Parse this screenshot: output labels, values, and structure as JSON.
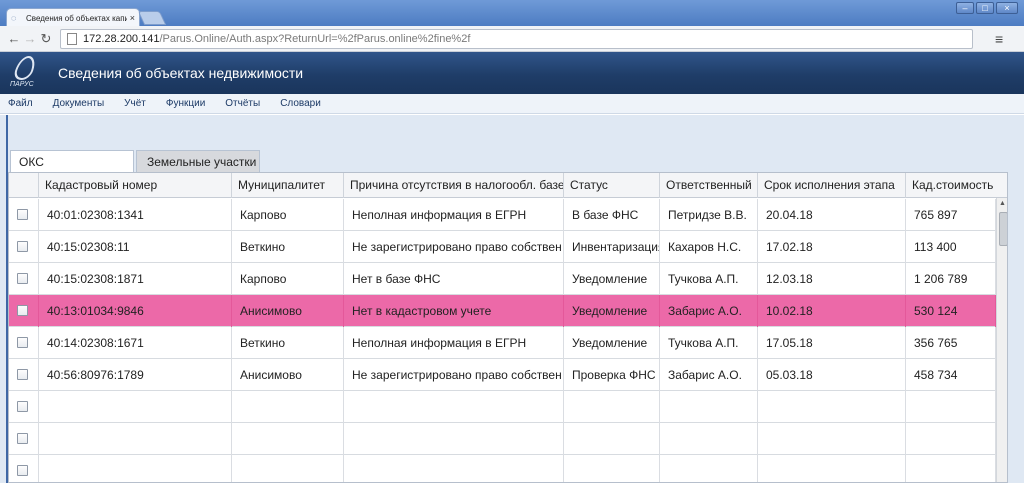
{
  "browser": {
    "tab_title": "Сведения об объектах капи",
    "tab_close": "×",
    "url_host": "172.28.200.141",
    "url_path": "/Parus.Online/Auth.aspx?ReturnUrl=%2fParus.online%2fine%2f"
  },
  "app": {
    "logo_text": "ПАРУС",
    "title": "Сведения об объектах  недвижимости"
  },
  "menu": [
    "Файл",
    "Документы",
    "Учёт",
    "Функции",
    "Отчёты",
    "Словари"
  ],
  "tabs": [
    {
      "label": "ОКС"
    },
    {
      "label": "Земельные участки"
    }
  ],
  "grid": {
    "columns": [
      "Кадастровый номер",
      "Муниципалитет",
      "Причина отсутствия в налогообл. базе",
      "Статус",
      "Ответственный",
      "Срок исполнения этапа",
      "Кад.стоимость"
    ],
    "rows": [
      {
        "cadastral": "40:01:02308:1341",
        "municipality": "Карпово",
        "reason": "Неполная информация в ЕГРН",
        "status": "В базе ФНС",
        "responsible": "Петридзе В.В.",
        "deadline": "20.04.18",
        "cost": "765 897"
      },
      {
        "cadastral": "40:15:02308:11",
        "municipality": "Веткино",
        "reason": "Не зарегистрировано право собствен",
        "status": "Инвентаризация",
        "responsible": "Кахаров Н.С.",
        "deadline": "17.02.18",
        "cost": "113 400"
      },
      {
        "cadastral": "40:15:02308:1871",
        "municipality": "Карпово",
        "reason": "Нет в базе ФНС",
        "status": "Уведомление",
        "responsible": "Тучкова А.П.",
        "deadline": "12.03.18",
        "cost": "1 206 789"
      },
      {
        "cadastral": "40:13:01034:9846",
        "municipality": "Анисимово",
        "reason": "Нет в кадастровом учете",
        "status": "Уведомление",
        "responsible": "Забарис А.О.",
        "deadline": "10.02.18",
        "cost": "530 124"
      },
      {
        "cadastral": "40:14:02308:1671",
        "municipality": "Веткино",
        "reason": "Неполная информация в ЕГРН",
        "status": "Уведомление",
        "responsible": "Тучкова А.П.",
        "deadline": "17.05.18",
        "cost": "356 765"
      },
      {
        "cadastral": "40:56:80976:1789",
        "municipality": "Анисимово",
        "reason": "Не зарегистрировано право собствен",
        "status": "Проверка ФНС",
        "responsible": "Забарис А.О.",
        "deadline": "05.03.18",
        "cost": "458 734"
      },
      {
        "cadastral": "",
        "municipality": "",
        "reason": "",
        "status": "",
        "responsible": "",
        "deadline": "",
        "cost": ""
      },
      {
        "cadastral": "",
        "municipality": "",
        "reason": "",
        "status": "",
        "responsible": "",
        "deadline": "",
        "cost": ""
      },
      {
        "cadastral": "",
        "municipality": "",
        "reason": "",
        "status": "",
        "responsible": "",
        "deadline": "",
        "cost": ""
      }
    ],
    "selected_row": 3
  }
}
